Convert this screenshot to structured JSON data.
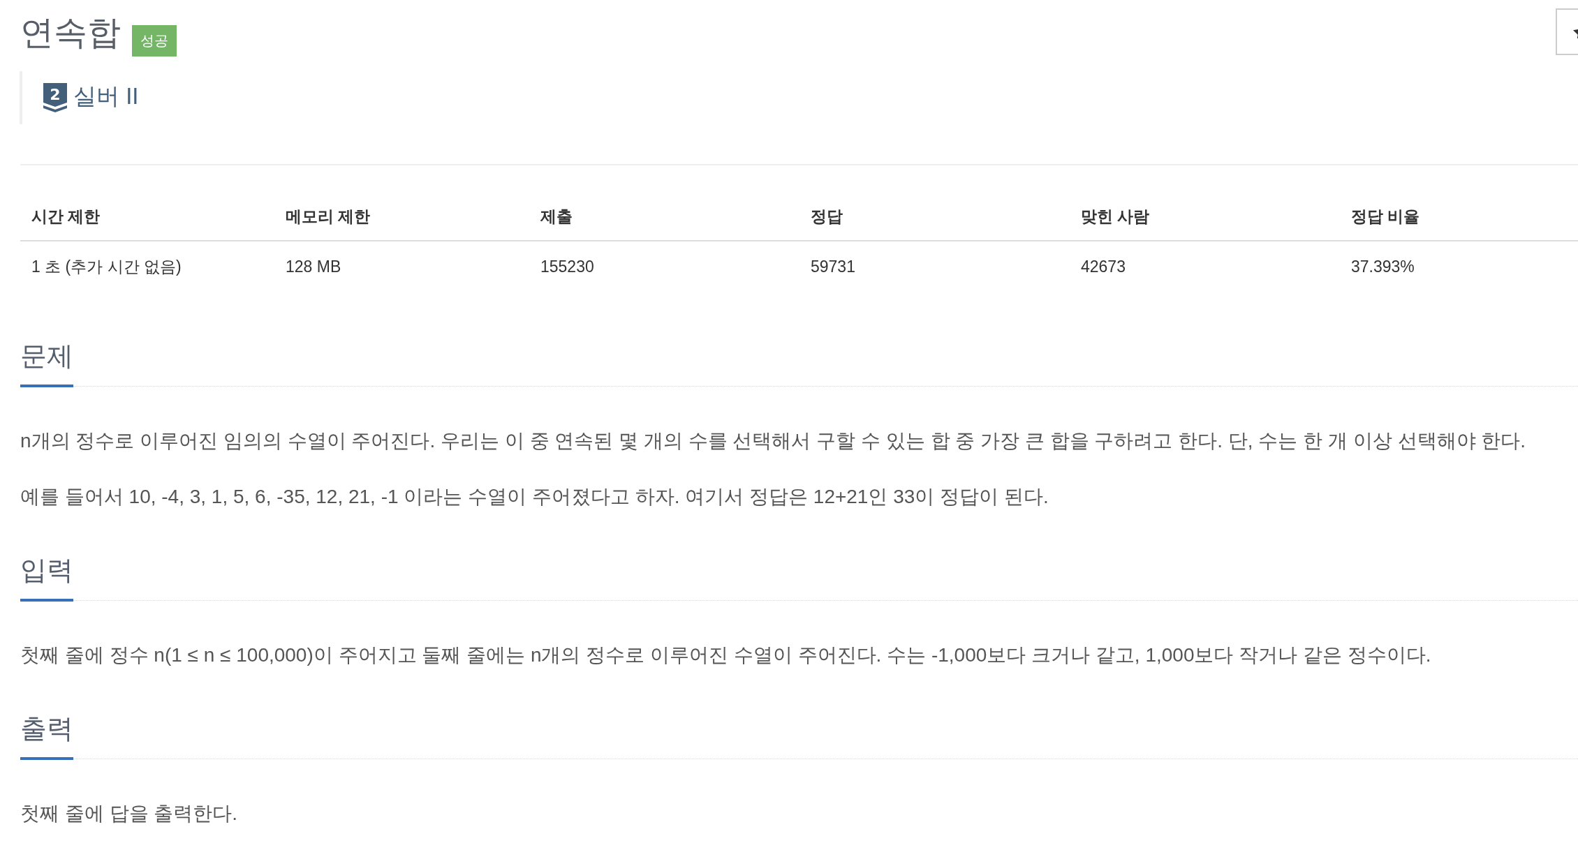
{
  "problem": {
    "title": "연속합",
    "status_badge": "성공"
  },
  "tier": {
    "number": "2",
    "name": "실버 II"
  },
  "info_table": {
    "columns": [
      "시간 제한",
      "메모리 제한",
      "제출",
      "정답",
      "맞힌 사람",
      "정답 비율"
    ],
    "rows": [
      [
        "1 초 (추가 시간 없음)",
        "128 MB",
        "155230",
        "59731",
        "42673",
        "37.393%"
      ]
    ]
  },
  "sections": [
    {
      "heading": "문제",
      "paragraphs": [
        "n개의 정수로 이루어진 임의의 수열이 주어진다. 우리는 이 중 연속된 몇 개의 수를 선택해서 구할 수 있는 합 중 가장 큰 합을 구하려고 한다. 단, 수는 한 개 이상 선택해야 한다.",
        "예를 들어서 10, -4, 3, 1, 5, 6, -35, 12, 21, -1 이라는 수열이 주어졌다고 하자. 여기서 정답은 12+21인 33이 정답이 된다."
      ]
    },
    {
      "heading": "입력",
      "paragraphs": [
        "첫째 줄에 정수 n(1 ≤ n ≤ 100,000)이 주어지고 둘째 줄에는 n개의 정수로 이루어진 수열이 주어진다. 수는 -1,000보다 크거나 같고, 1,000보다 작거나 같은 정수이다."
      ]
    },
    {
      "heading": "출력",
      "paragraphs": [
        "첫째 줄에 답을 출력한다."
      ]
    }
  ]
}
